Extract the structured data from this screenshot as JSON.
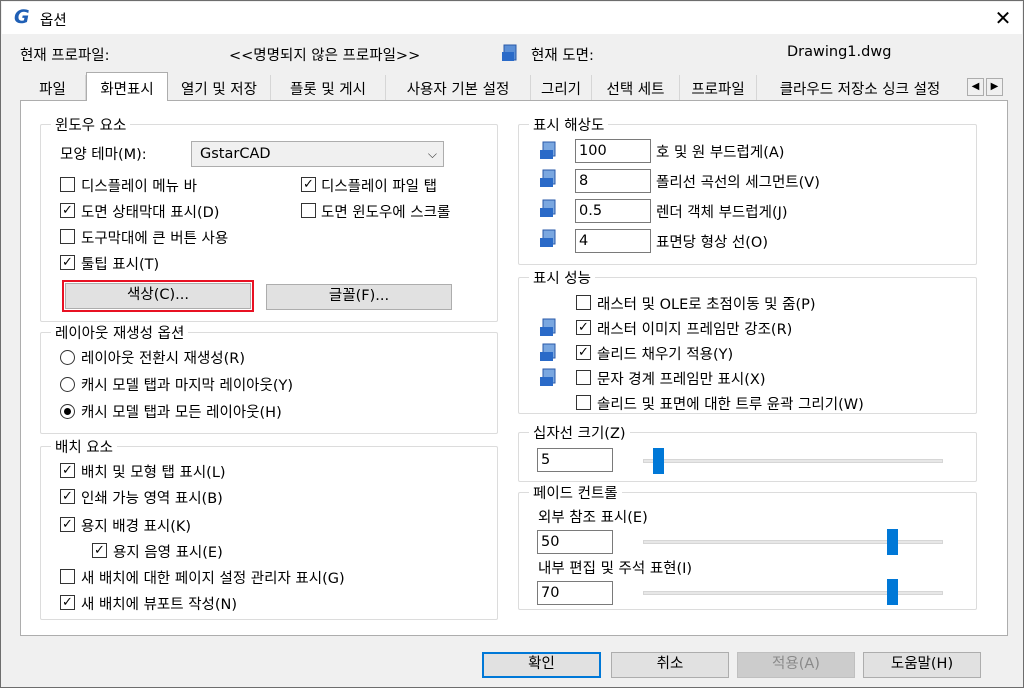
{
  "window": {
    "title": "옵션",
    "close_glyph": "✕"
  },
  "info": {
    "profile_label": "현재 프로파일:",
    "profile_value": "<<명명되지 않은 프로파일>>",
    "drawing_label": "현재 도면:",
    "drawing_value": "Drawing1.dwg"
  },
  "tabs": [
    {
      "label": "파일"
    },
    {
      "label": "화면표시",
      "active": true
    },
    {
      "label": "열기 및 저장"
    },
    {
      "label": "플롯 및 게시"
    },
    {
      "label": "사용자 기본 설정"
    },
    {
      "label": "그리기"
    },
    {
      "label": "선택 세트"
    },
    {
      "label": "프로파일"
    },
    {
      "label": "클라우드 저장소 싱크 설정"
    }
  ],
  "tab_scroll": {
    "left": "◀",
    "right": "▶"
  },
  "window_elements": {
    "title": "윈도우 요소",
    "theme_label": "모양 테마(M):",
    "theme_value": "GstarCAD",
    "checkboxes": [
      {
        "label": "디스플레이 메뉴 바",
        "checked": false
      },
      {
        "label": "디스플레이 파일 탭",
        "checked": true
      },
      {
        "label": "도면 상태막대 표시(D)",
        "checked": true
      },
      {
        "label": "도면 윈도우에 스크롤",
        "checked": false
      },
      {
        "label": "도구막대에 큰 버튼 사용",
        "checked": false
      },
      {
        "label": "툴팁 표시(T)",
        "checked": true
      }
    ],
    "colors_button": "색상(C)...",
    "fonts_button": "글꼴(F)..."
  },
  "layout_regen": {
    "title": "레이아웃 재생성 옵션",
    "options": [
      {
        "label": "레이아웃 전환시 재생성(R)",
        "selected": false
      },
      {
        "label": "캐시 모델 탭과 마지막 레이아웃(Y)",
        "selected": false
      },
      {
        "label": "캐시 모델 탭과 모든 레이아웃(H)",
        "selected": true
      }
    ]
  },
  "layout_elements": {
    "title": "배치 요소",
    "checkboxes": [
      {
        "label": "배치 및 모형 탭 표시(L)",
        "checked": true
      },
      {
        "label": "인쇄 가능 영역 표시(B)",
        "checked": true
      },
      {
        "label": "용지 배경 표시(K)",
        "checked": true
      },
      {
        "label": "용지 음영 표시(E)",
        "checked": true
      },
      {
        "label": "새 배치에 대한 페이지 설정 관리자 표시(G)",
        "checked": false
      },
      {
        "label": "새 배치에 뷰포트 작성(N)",
        "checked": true
      }
    ]
  },
  "display_resolution": {
    "title": "표시 해상도",
    "rows": [
      {
        "value": "100",
        "label": "호 및 원 부드럽게(A)"
      },
      {
        "value": "8",
        "label": "폴리선 곡선의 세그먼트(V)"
      },
      {
        "value": "0.5",
        "label": "렌더 객체 부드럽게(J)"
      },
      {
        "value": "4",
        "label": "표면당 형상 선(O)"
      }
    ]
  },
  "display_performance": {
    "title": "표시 성능",
    "checkboxes": [
      {
        "label": "래스터 및 OLE로 초점이동 및 줌(P)",
        "checked": false
      },
      {
        "label": "래스터 이미지 프레임만 강조(R)",
        "checked": true
      },
      {
        "label": "솔리드 채우기 적용(Y)",
        "checked": true
      },
      {
        "label": "문자 경계 프레임만 표시(X)",
        "checked": false
      },
      {
        "label": "솔리드 및 표면에 대한 트루 윤곽 그리기(W)",
        "checked": false
      }
    ]
  },
  "crosshair": {
    "title": "십자선 크기(Z)",
    "value": "5",
    "level_fraction": 0.05
  },
  "fade": {
    "title": "페이드 컨트롤",
    "xref_label": "외부 참조 표시(E)",
    "xref_value": "50",
    "xref_fraction": 0.83,
    "inplace_label": "내부 편집 및 주석 표현(I)",
    "inplace_value": "70",
    "inplace_fraction": 0.83
  },
  "footer": {
    "ok": "확인",
    "cancel": "취소",
    "apply": "적용(A)",
    "help": "도움말(H)"
  },
  "colors": {
    "accent": "#0078d7",
    "highlight_border": "#e81123",
    "brand": "#1f5fb5"
  },
  "icons": {
    "app": "gstarcad-logo-icon",
    "drawing": "dwg-file-icon",
    "check": "✓"
  }
}
